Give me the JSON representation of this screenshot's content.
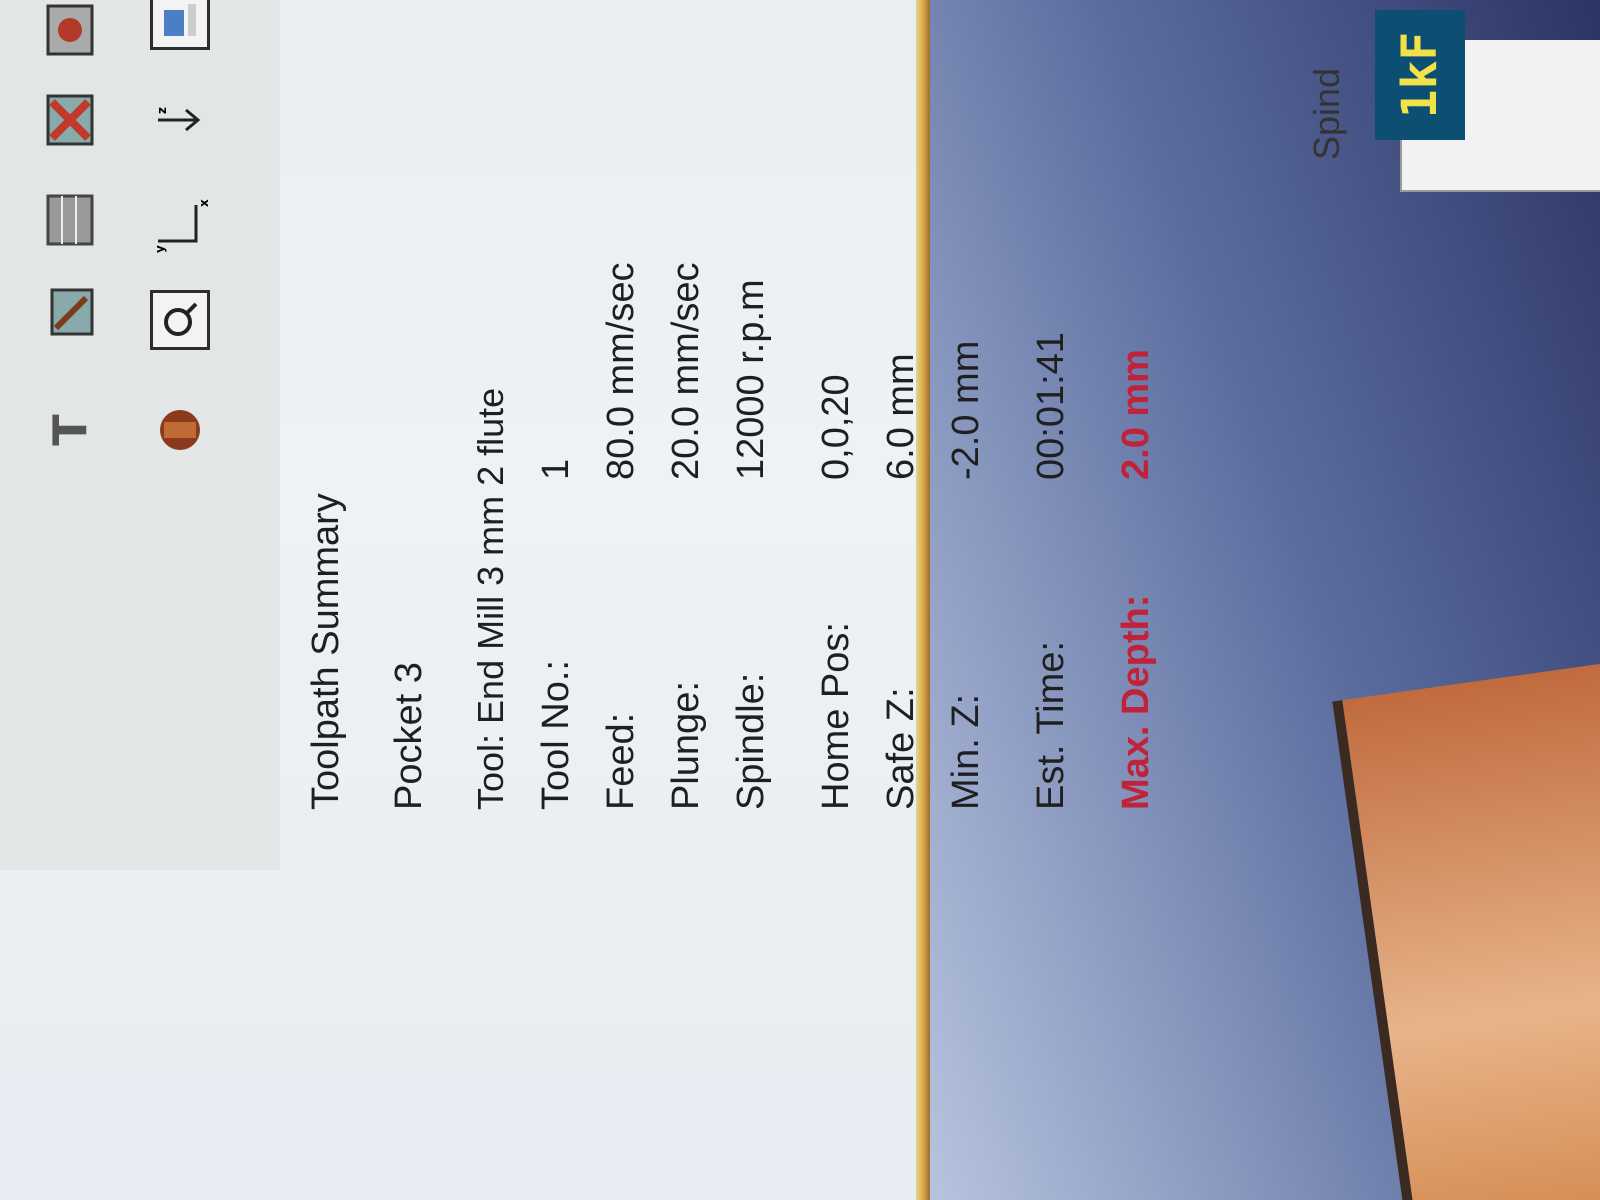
{
  "toolbar": {
    "icons": [
      "text-tool-icon",
      "gcode-icon",
      "table-icon",
      "delete-icon",
      "settings-icon",
      "save-icon",
      "lathe-icon",
      "preview-icon",
      "axis-icon",
      "z-axis-icon",
      "layer-icon"
    ]
  },
  "summary": {
    "title": "Toolpath Summary",
    "toolpath_name": "Pocket 3",
    "tool": "Tool: End Mill 3 mm 2 flute",
    "rows": [
      {
        "label": "Tool No.:",
        "value": "1"
      },
      {
        "label": "Feed:",
        "value": "80.0 mm/sec"
      },
      {
        "label": "Plunge:",
        "value": "20.0 mm/sec"
      },
      {
        "label": "Spindle:",
        "value": "12000 r.p.m"
      },
      {
        "label": "Home Pos:",
        "value": "0,0,20"
      },
      {
        "label": "Safe Z:",
        "value": "6.0 mm"
      },
      {
        "label": "Min. Z:",
        "value": "-2.0 mm"
      },
      {
        "label": "Est. Time:",
        "value": "00:01:41"
      },
      {
        "label": "Max. Depth:",
        "value": "2.0 mm"
      }
    ]
  },
  "side_panel": {
    "spindle_label": "Spind",
    "speed_display": "1kF"
  },
  "colors": {
    "alert": "#c0223a",
    "display_bg": "#0c4f73",
    "display_fg": "#f1e24a"
  }
}
